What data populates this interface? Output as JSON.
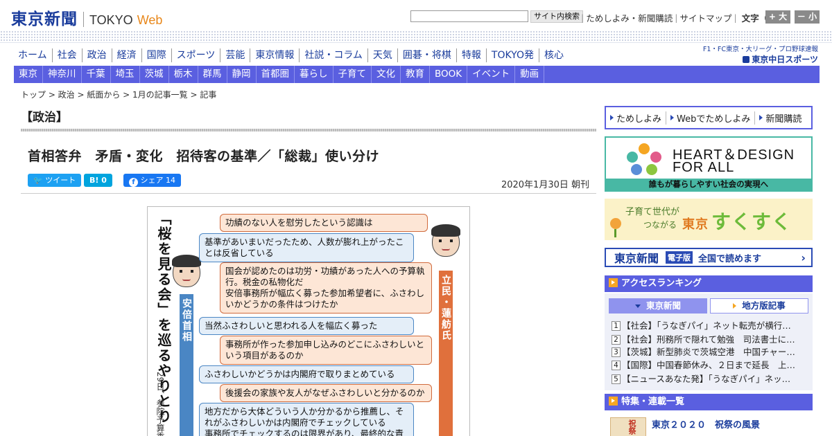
{
  "header": {
    "logo_main": "東京新聞",
    "logo_sub1": "TOKYO",
    "logo_sub2": "Web",
    "search_placeholder": "",
    "search_button": "サイト内検索",
    "links": [
      "ためしよみ・新聞購読",
      "サイトマップ"
    ],
    "font_size_label": "文字（0）",
    "font_bigger": "+ 大",
    "font_smaller": "－ 小"
  },
  "nav_main": [
    "ホーム",
    "社会",
    "政治",
    "経済",
    "国際",
    "スポーツ",
    "芸能",
    "東京情報",
    "社説・コラム",
    "天気",
    "囲碁・将棋",
    "特報",
    "TOKYO発",
    "核心"
  ],
  "chunichi": {
    "line1": "F1・FC東京・大リーグ・プロ野球速報",
    "line2": "東京中日スポーツ"
  },
  "nav_regions": [
    "東京",
    "神奈川",
    "千葉",
    "埼玉",
    "茨城",
    "栃木",
    "群馬",
    "静岡",
    "首都圏",
    "暮らし",
    "子育て",
    "文化",
    "教育",
    "BOOK",
    "イベント",
    "動画"
  ],
  "breadcrumb": "トップ > 政治 > 紙面から > 1月の記事一覧 > 記事",
  "article": {
    "category": "【政治】",
    "headline": "首相答弁　矛盾・変化　招待客の基準／「総裁」使い分け",
    "tweet_label": "ツイート",
    "hatena_label": "B!  0",
    "fb_label": "シェア 14",
    "date": "2020年1月30日 朝刊"
  },
  "figure": {
    "title": "「桜を見る会」を巡るやりとり",
    "subtitle": "29日、参院予算委",
    "abe_label": "安倍首相",
    "renho_label": "立民・蓮舫氏",
    "bubbles": [
      {
        "speaker": "renho",
        "text": "功績のない人を慰労したという認識は"
      },
      {
        "speaker": "abe",
        "text": "基準があいまいだったため、人数が膨れ上がったことは反省している"
      },
      {
        "speaker": "renho",
        "text": "国会が認めたのは功労・功績があった人への予算執行。税金の私物化だ\n安倍事務所が幅広く募った参加希望者に、ふさわしいかどうかの条件はつけたか"
      },
      {
        "speaker": "abe",
        "text": "当然ふさわしいと思われる人を幅広く募った"
      },
      {
        "speaker": "renho",
        "text": "事務所が作った参加申し込みのどこにふさわしいという項目があるのか"
      },
      {
        "speaker": "abe",
        "text": "ふさわしいかどうかは内閣府で取りまとめている"
      },
      {
        "speaker": "renho",
        "text": "後援会の家族や友人がなぜふさわしいと分かるのか"
      },
      {
        "speaker": "abe",
        "text": "地方だから大体どういう人か分かるから推薦し、それがふさわしいかは内閣府でチェックしている\n事務所でチェックするのは限界があり、最終的な責"
      }
    ]
  },
  "sidebar": {
    "tabs": [
      "ためしよみ",
      "Webでためしよみ",
      "新聞購読"
    ],
    "heart": {
      "line1": "HEART＆DESIGN",
      "line2": "FOR ALL",
      "footer": "誰もが暮らしやすい社会の実現へ"
    },
    "sukusuku": {
      "line1": "子育て世代が",
      "line2": "つながる",
      "prefix": "東京",
      "title": "すくすく"
    },
    "denshi": {
      "logo": "東京新聞",
      "badge": "電子版",
      "text": "全国で読めます",
      "chevron": "›"
    },
    "ranking_title": "アクセスランキング",
    "ranking_tab1": "東京新聞",
    "ranking_tab2": "地方版記事",
    "ranking": [
      {
        "num": "1",
        "text": "【社会】「うなぎパイ」ネット転売が横行…"
      },
      {
        "num": "2",
        "text": "【社会】刑務所で隠れて勉強　司法書士に…"
      },
      {
        "num": "3",
        "text": "【茨城】新型肺炎で茨城空港　中国チャー…"
      },
      {
        "num": "4",
        "text": "【国際】中国春節休み、２日まで延長　上…"
      },
      {
        "num": "5",
        "text": "【ニュースあなた発】「うなぎパイ」ネッ…"
      }
    ],
    "tokushu_title": "特集・連載一覧",
    "tokushu_item": "東京２０２０　祝祭の風景",
    "tokushu_img_text": "祝祭"
  },
  "colors": {
    "brand_blue": "#1a3c9c",
    "nav_purple": "#5a5fe0",
    "accent_orange": "#e8871a",
    "teal": "#48b8a4"
  }
}
